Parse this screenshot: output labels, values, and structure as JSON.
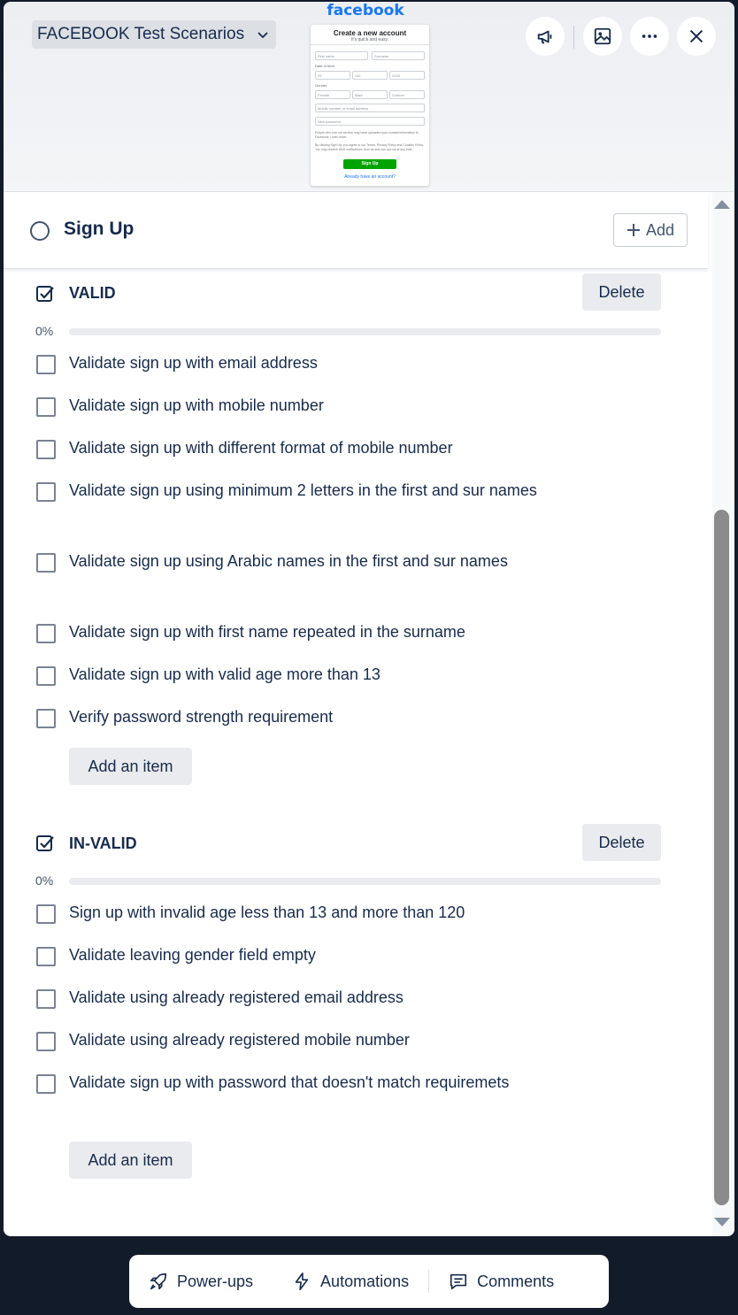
{
  "board": {
    "name": "FACEBOOK Test Scenarios"
  },
  "cover": {
    "logo": "facebook",
    "form_title": "Create a new account",
    "form_subtitle": "It's quick and easy.",
    "first_name": "First name",
    "surname": "Surname",
    "dob_label": "Date of birth",
    "day": "25",
    "month": "Oct",
    "year": "2025",
    "gender_label": "Gender",
    "female": "Female",
    "male": "Male",
    "custom": "Custom",
    "mobile_email": "Mobile number or email address",
    "new_password": "New password",
    "fine_print_1": "People who use our service may have uploaded your contact information to Facebook. Learn more.",
    "fine_print_2": "By clicking Sign Up, you agree to our Terms, Privacy Policy and Cookies Policy. You may receive SMS notifications from us and can opt out at any time.",
    "signup_button": "Sign Up",
    "login_link": "Already have an account?"
  },
  "header_icons": [
    "megaphone-icon",
    "image-icon",
    "more-icon",
    "close-icon"
  ],
  "card": {
    "title": "Sign Up",
    "add_label": "Add"
  },
  "checklists": [
    {
      "title": "VALID",
      "delete_label": "Delete",
      "progress_label": "0%",
      "progress": 0,
      "items": [
        "Validate sign up with email address",
        "Validate sign up with mobile number",
        "Validate sign up with different format of mobile number",
        "Validate sign up using minimum 2 letters in the first and sur names",
        "Validate sign up using Arabic names in the first and sur names",
        "Validate sign up with first name repeated in the surname",
        "Validate sign up with valid age more than 13",
        "Verify password strength requirement"
      ],
      "add_item_label": "Add an item"
    },
    {
      "title": "IN-VALID",
      "delete_label": "Delete",
      "progress_label": "0%",
      "progress": 0,
      "items": [
        "Sign up with invalid age less than 13 and more than 120",
        "Validate leaving gender field empty",
        "Validate using already registered email address",
        "Validate using already registered mobile number",
        "Validate sign up with password that doesn't match requiremets"
      ],
      "add_item_label": "Add an item"
    }
  ],
  "bottom_bar": {
    "powerups": "Power-ups",
    "automations": "Automations",
    "comments": "Comments"
  }
}
